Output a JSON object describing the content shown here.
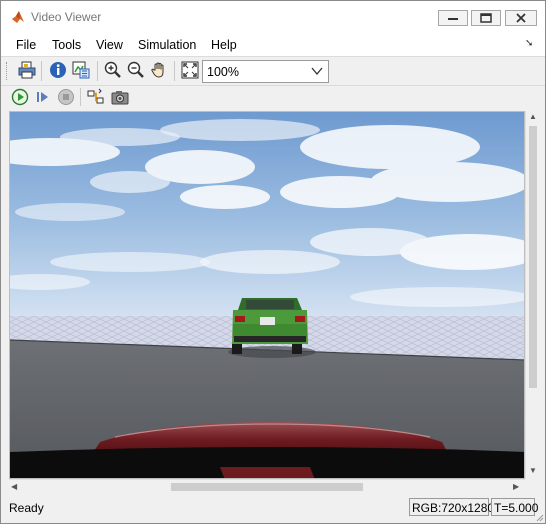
{
  "window": {
    "title": "Video Viewer"
  },
  "menu": {
    "items": [
      "File",
      "Tools",
      "View",
      "Simulation",
      "Help"
    ]
  },
  "toolbar": {
    "row1_icons": [
      "print-icon",
      "info-icon",
      "pixel-region-icon",
      "zoom-in-icon",
      "zoom-out-icon",
      "pan-hand-icon",
      "fit-to-window-icon"
    ],
    "zoom_level": "100%",
    "row2_icons": [
      "run-icon",
      "step-forward-icon",
      "stop-icon",
      "highlight-signal-icon",
      "snapshot-icon"
    ]
  },
  "scene": {
    "description_icons": [
      "sky",
      "clouds",
      "ground-grid",
      "road",
      "green-suv",
      "ego-hood"
    ],
    "colors": {
      "sky_top": "#6e9ad0",
      "sky_bottom": "#c9dcf0",
      "road": "#5c5f63",
      "car": "#4c9a3b",
      "hood": "#7a1c20"
    }
  },
  "status": {
    "text": "Ready",
    "format": "RGB:720x1280",
    "time": "T=5.000"
  }
}
